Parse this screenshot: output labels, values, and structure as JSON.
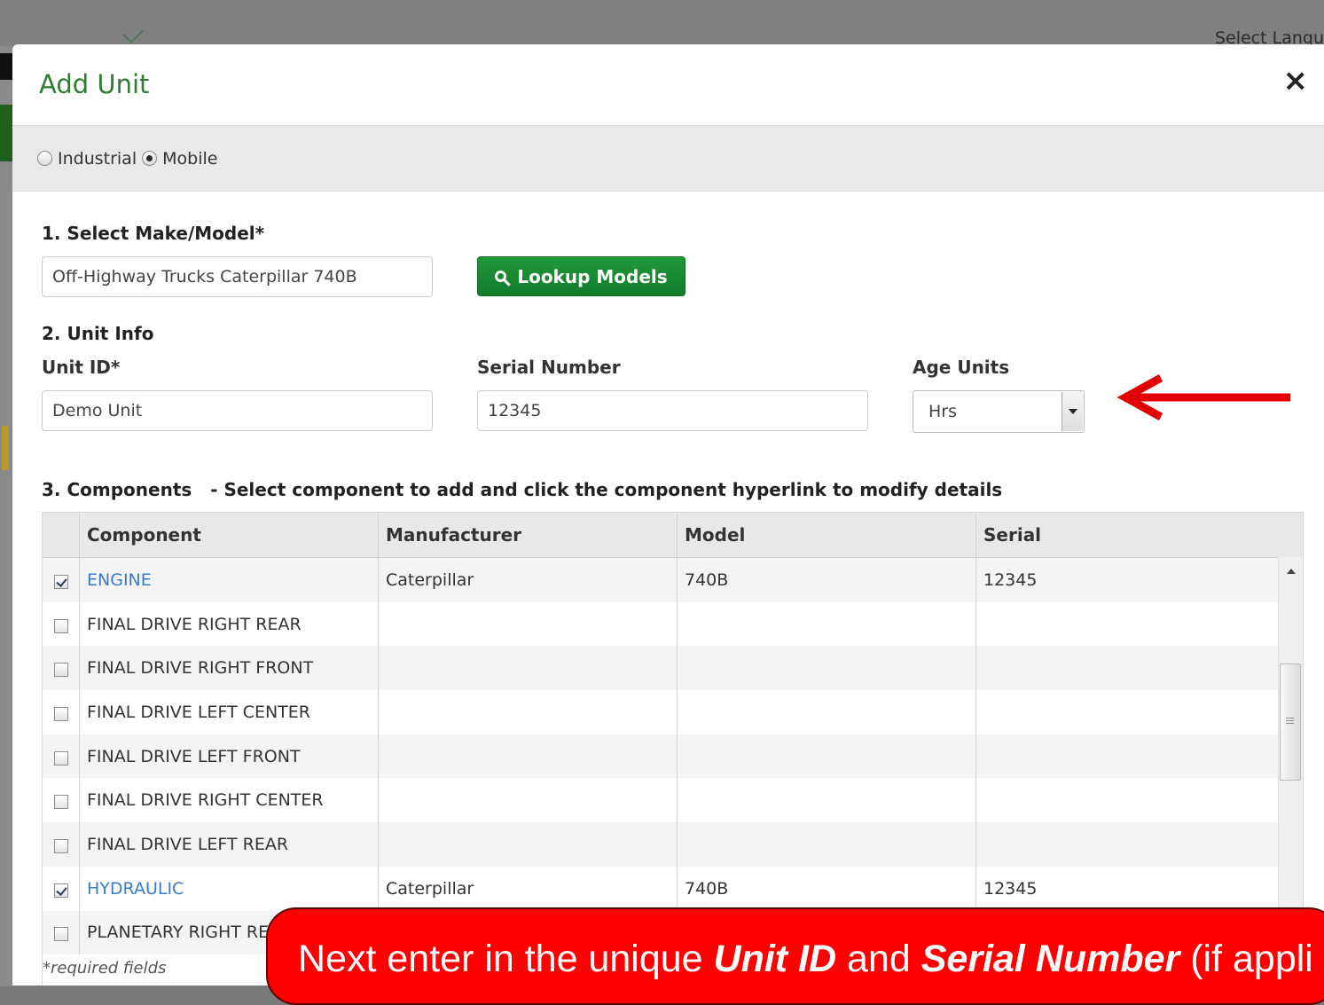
{
  "background": {
    "language_label": "Select Langu"
  },
  "modal": {
    "title": "Add Unit",
    "close_symbol": "×"
  },
  "unit_type": {
    "options": [
      "Industrial",
      "Mobile"
    ],
    "selected": "Mobile"
  },
  "make_model": {
    "section_label": "1. Select Make/Model*",
    "value": "Off-Highway Trucks Caterpillar 740B",
    "lookup_label": "Lookup Models"
  },
  "unit_info": {
    "section_label": "2. Unit Info",
    "unit_id_label": "Unit ID*",
    "unit_id_value": "Demo Unit",
    "serial_label": "Serial Number",
    "serial_value": "12345",
    "age_units_label": "Age Units",
    "age_units_value": "Hrs"
  },
  "components": {
    "section_label": "3. Components",
    "section_hint": "- Select component to add and click the component hyperlink to modify details",
    "headers": [
      "Component",
      "Manufacturer",
      "Model",
      "Serial"
    ],
    "rows": [
      {
        "checked": true,
        "component": "ENGINE",
        "manufacturer": "Caterpillar",
        "model": "740B",
        "serial": "12345"
      },
      {
        "checked": false,
        "component": "FINAL DRIVE RIGHT REAR",
        "manufacturer": "",
        "model": "",
        "serial": ""
      },
      {
        "checked": false,
        "component": "FINAL DRIVE RIGHT FRONT",
        "manufacturer": "",
        "model": "",
        "serial": ""
      },
      {
        "checked": false,
        "component": "FINAL DRIVE LEFT CENTER",
        "manufacturer": "",
        "model": "",
        "serial": ""
      },
      {
        "checked": false,
        "component": "FINAL DRIVE LEFT FRONT",
        "manufacturer": "",
        "model": "",
        "serial": ""
      },
      {
        "checked": false,
        "component": "FINAL DRIVE RIGHT CENTER",
        "manufacturer": "",
        "model": "",
        "serial": ""
      },
      {
        "checked": false,
        "component": "FINAL DRIVE LEFT REAR",
        "manufacturer": "",
        "model": "",
        "serial": ""
      },
      {
        "checked": true,
        "component": "HYDRAULIC",
        "manufacturer": "Caterpillar",
        "model": "740B",
        "serial": "12345"
      },
      {
        "checked": false,
        "component": "PLANETARY RIGHT RE",
        "manufacturer": "",
        "model": "",
        "serial": ""
      }
    ]
  },
  "required_note": "*required fields",
  "callout": {
    "prefix": "Next enter in the unique ",
    "unit_id": "Unit ID",
    "and": " and ",
    "serial": "Serial Number",
    "suffix": " (if appli"
  },
  "colors": {
    "title_green": "#2e7d32",
    "button_green": "#1a8a34",
    "link_blue": "#3a7bc8",
    "callout_red": "#ff0000"
  }
}
